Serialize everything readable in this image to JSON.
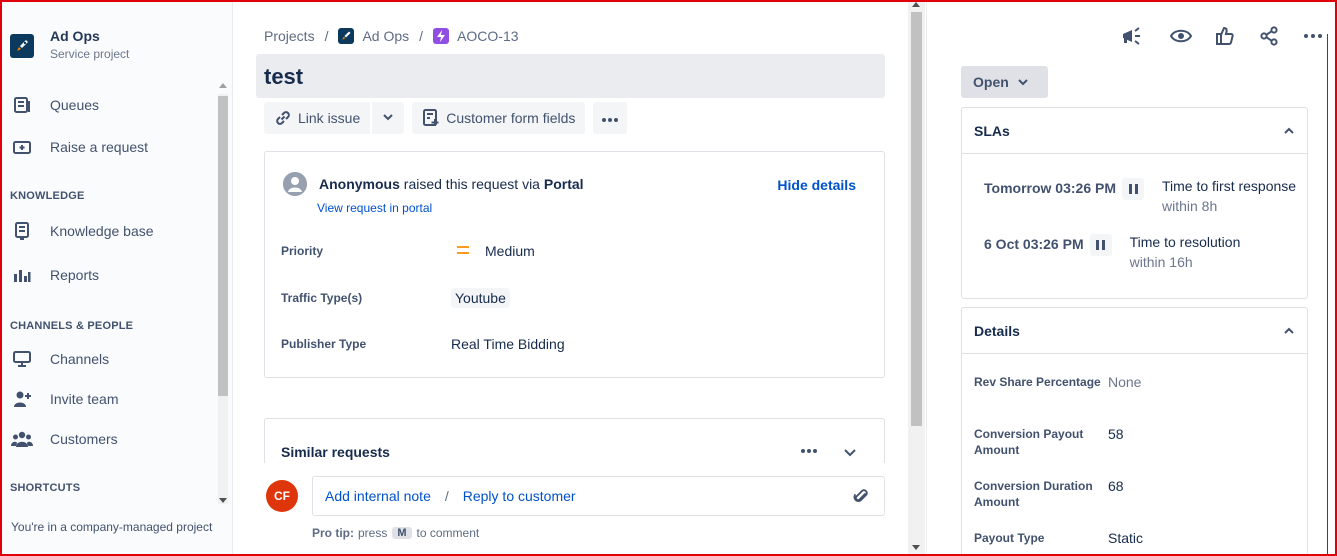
{
  "sidebar": {
    "project_name": "Ad Ops",
    "project_type": "Service project",
    "queues": "Queues",
    "raise_request": "Raise a request",
    "knowledge_heading": "KNOWLEDGE",
    "knowledge_base": "Knowledge base",
    "reports": "Reports",
    "channels_heading": "CHANNELS & PEOPLE",
    "channels": "Channels",
    "invite_team": "Invite team",
    "customers": "Customers",
    "shortcuts_heading": "SHORTCUTS",
    "footer": "You're in a company-managed project"
  },
  "breadcrumb": {
    "projects": "Projects",
    "project": "Ad Ops",
    "issue_key": "AOCO-13",
    "separator": "/"
  },
  "issue": {
    "summary": "test"
  },
  "actions": {
    "link_issue": "Link issue",
    "customer_form_fields": "Customer form fields"
  },
  "request": {
    "reporter": "Anonymous",
    "raised_text": "raised this request via",
    "channel": "Portal",
    "view_portal": "View request in portal",
    "hide_details": "Hide details",
    "fields": {
      "priority_label": "Priority",
      "priority_value": "Medium",
      "traffic_label": "Traffic Type(s)",
      "traffic_value": "Youtube",
      "publisher_label": "Publisher Type",
      "publisher_value": "Real Time Bidding"
    }
  },
  "similar": {
    "title": "Similar requests"
  },
  "comment": {
    "avatar_initials": "CF",
    "add_internal_note": "Add internal note",
    "separator": "/",
    "reply_to_customer": "Reply to customer",
    "protip_bold": "Pro tip:",
    "protip_press": "press",
    "protip_key": "M",
    "protip_rest": "to comment"
  },
  "right_panel": {
    "status": "Open",
    "slas": {
      "title": "SLAs",
      "items": [
        {
          "time": "Tomorrow 03:26 PM",
          "goal": "Time to first response",
          "within": "within 8h"
        },
        {
          "time": "6 Oct 03:26 PM",
          "goal": "Time to resolution",
          "within": "within 16h"
        }
      ]
    },
    "details": {
      "title": "Details",
      "rows": [
        {
          "label": "Rev Share Percentage",
          "value": "None"
        },
        {
          "label": "Conversion Payout Amount",
          "value": "58"
        },
        {
          "label": "Conversion Duration Amount",
          "value": "68"
        },
        {
          "label": "Payout Type",
          "value": "Static"
        }
      ]
    }
  },
  "colors": {
    "accent": "#0052cc",
    "priority_medium": "#ff991f",
    "avatar_cf": "#de350b",
    "frame_border": "#e0000c"
  }
}
